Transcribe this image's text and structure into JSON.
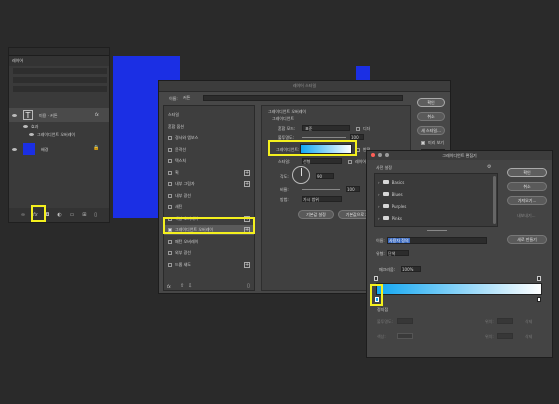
{
  "layers_panel": {
    "tab": "레이어",
    "layers": [
      {
        "name": "미용 · 커튼",
        "fx": "fx"
      },
      {
        "name": "효과"
      },
      {
        "name": "그레이디언트 오버레이"
      },
      {
        "name": "배경"
      }
    ],
    "footer_icons": [
      "link-icon",
      "fx-icon",
      "mask-icon",
      "adjustment-icon",
      "folder-icon",
      "new-layer-icon",
      "trash-icon"
    ],
    "fx_label": "fx"
  },
  "layer_style": {
    "title": "레이어 스타일",
    "name_label": "이름:",
    "name_value": "커튼",
    "left_items": [
      {
        "label": "스타일",
        "checkbox": false,
        "plus": false
      },
      {
        "label": "혼합 옵션",
        "checkbox": false,
        "plus": false
      },
      {
        "label": "경사와 엠보스",
        "checkbox": true,
        "plus": false
      },
      {
        "label": "윤곽선",
        "checkbox": true,
        "plus": false
      },
      {
        "label": "텍스처",
        "checkbox": true,
        "plus": false
      },
      {
        "label": "획",
        "checkbox": true,
        "plus": true
      },
      {
        "label": "내부 그림자",
        "checkbox": true,
        "plus": true
      },
      {
        "label": "내부 광선",
        "checkbox": true,
        "plus": false
      },
      {
        "label": "새틴",
        "checkbox": true,
        "plus": false
      },
      {
        "label": "색상 오버레이",
        "checkbox": true,
        "plus": true
      },
      {
        "label": "그레이디언트 오버레이",
        "checkbox": true,
        "plus": true,
        "checked": true
      },
      {
        "label": "패턴 오버레이",
        "checkbox": true,
        "plus": false
      },
      {
        "label": "외부 광선",
        "checkbox": true,
        "plus": false
      },
      {
        "label": "드롭 섀도",
        "checkbox": true,
        "plus": true
      }
    ],
    "fx_footer": "fx",
    "section_title": "그레이디언트 오버레이",
    "section_sub": "그레이디언트",
    "blend_label": "혼합 모드:",
    "blend_value": "표준",
    "dither": "디더",
    "opacity_label": "불투명도:",
    "opacity_value": "100",
    "gradient_label": "그레이디언트:",
    "reverse": "반전",
    "style_label": "스타일:",
    "style_value": "선형",
    "align": "레이어에 정렬",
    "angle_label": "각도:",
    "angle_value": "90",
    "scale_label": "비율:",
    "scale_value": "100",
    "method_label": "방법:",
    "method_value": "가시 범위",
    "default_btn": "기본값 설정",
    "reset_btn": "기본값으로 재설정",
    "buttons": [
      "확인",
      "취소",
      "새 스타일...",
      "미리 보기"
    ]
  },
  "gradient_editor": {
    "title": "그레이디언트 편집기",
    "presets_label": "사전 설정",
    "folders": [
      "Basics",
      "Blues",
      "Purples",
      "Pinks"
    ],
    "buttons": [
      "확인",
      "취소",
      "가져오기...",
      "내보내기..."
    ],
    "name_label": "이름:",
    "name_value": "사용자 정의",
    "new_btn": "새로 만들기",
    "type_label": "유형:",
    "type_value": "단색",
    "smooth_label": "매끄러움:",
    "smooth_value": "100%",
    "stops_label": "정지점",
    "opacity_label": "불투명도:",
    "location_label": "위치:",
    "delete_label": "삭제",
    "color_label": "색상:",
    "gradient_from": "#12a7f2",
    "gradient_to": "#ffffff"
  },
  "colors": {
    "highlight": "#f4f01e",
    "canvas": "#1b2fe4"
  }
}
